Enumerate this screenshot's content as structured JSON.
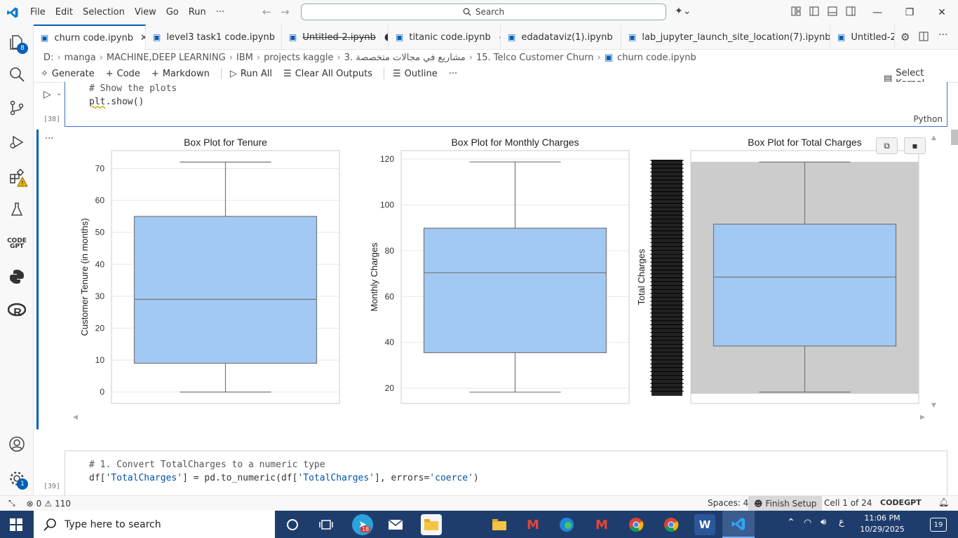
{
  "titlebar": {
    "menu": [
      "File",
      "Edit",
      "Selection",
      "View",
      "Go",
      "Run",
      "···"
    ],
    "search_label": "Search"
  },
  "activity_badges": {
    "explorer": "8",
    "settings": "1"
  },
  "tabs": [
    {
      "label": "churn code.ipynb",
      "active": true,
      "state": "close"
    },
    {
      "label": "level3 task1 code.ipynb",
      "state": "dirty"
    },
    {
      "label": "Untitled-2.ipynb",
      "state": "dirty",
      "strike": true
    },
    {
      "label": "titanic code.ipynb",
      "state": "dirty"
    },
    {
      "label": "edadataviz(1).ipynb",
      "state": "dirty"
    },
    {
      "label": "lab_jupyter_launch_site_location(7).ipynb",
      "state": "dirty"
    },
    {
      "label": "Untitled-2"
    }
  ],
  "breadcrumb": [
    "D:",
    "manga",
    "MACHINE,DEEP LEARNING",
    "IBM",
    "projects kaggle",
    "3. مشاريع في مجالات متخصصة",
    "15. Telco Customer Churn",
    "churn code.ipynb"
  ],
  "toolbar": {
    "generate": "Generate",
    "code": "Code",
    "markdown": "Markdown",
    "run_all": "Run All",
    "clear_outputs": "Clear All Outputs",
    "outline": "Outline",
    "more": "···",
    "select_kernel": "Select Kernel"
  },
  "cell38": {
    "line1": "# Show the plots",
    "line2_fn": "plt",
    "line2_rest": ".show()",
    "exec_count": "[38]",
    "language": "Python"
  },
  "cell39": {
    "line1": "# 1. Convert TotalCharges to a numeric type",
    "line2a": "df[",
    "line2b": "'TotalCharges'",
    "line2c": "] = pd.to_numeric(df[",
    "line2d": "'TotalCharges'",
    "line2e": "], errors=",
    "line2f": "'coerce'",
    "line2g": ")",
    "exec_count": "[39]"
  },
  "output_menu": "···",
  "chart_data": [
    {
      "type": "box",
      "title": "Box Plot for Tenure",
      "ylabel": "Customer Tenure (in months)",
      "ylim": [
        -3.6,
        75.6
      ],
      "yticks": [
        0,
        10,
        20,
        30,
        40,
        50,
        60,
        70
      ],
      "box": {
        "min": 0,
        "q1": 9,
        "median": 29,
        "q3": 55,
        "max": 72
      },
      "color": "#a1c9f4"
    },
    {
      "type": "box",
      "title": "Box Plot for Monthly Charges",
      "ylabel": "Monthly Charges",
      "ylim": [
        13.3,
        123.7
      ],
      "yticks": [
        20,
        40,
        60,
        80,
        100,
        120
      ],
      "box": {
        "min": 18.25,
        "q1": 35.5,
        "median": 70.35,
        "q3": 89.85,
        "max": 118.75
      },
      "color": "#a1c9f4"
    },
    {
      "type": "box",
      "title": "Box Plot for Total Charges",
      "ylabel": "Total Charges",
      "note": "y-axis category tick labels overlap into a dense black band",
      "box": {
        "min": 0.0,
        "q1": 0.2,
        "median": 0.5,
        "q3": 0.73,
        "max": 1.0
      },
      "color": "#a1c9f4"
    }
  ],
  "statusbar": {
    "errors": "0",
    "warnings": "110",
    "spaces": "Spaces: 4",
    "finish_setup": "Finish Setup",
    "cell_pos": "Cell 1 of 24",
    "codegpt": "CODEGPT"
  },
  "taskbar": {
    "search_placeholder": "Type here to search",
    "time": "11:06 PM",
    "date": "10/29/2025",
    "lang": "ع",
    "notif_count": "19",
    "telegram_badge": "18"
  },
  "colors": {
    "accent": "#005fb8",
    "box_fill": "#a1c9f4",
    "cell_border": "#3b73c6"
  }
}
